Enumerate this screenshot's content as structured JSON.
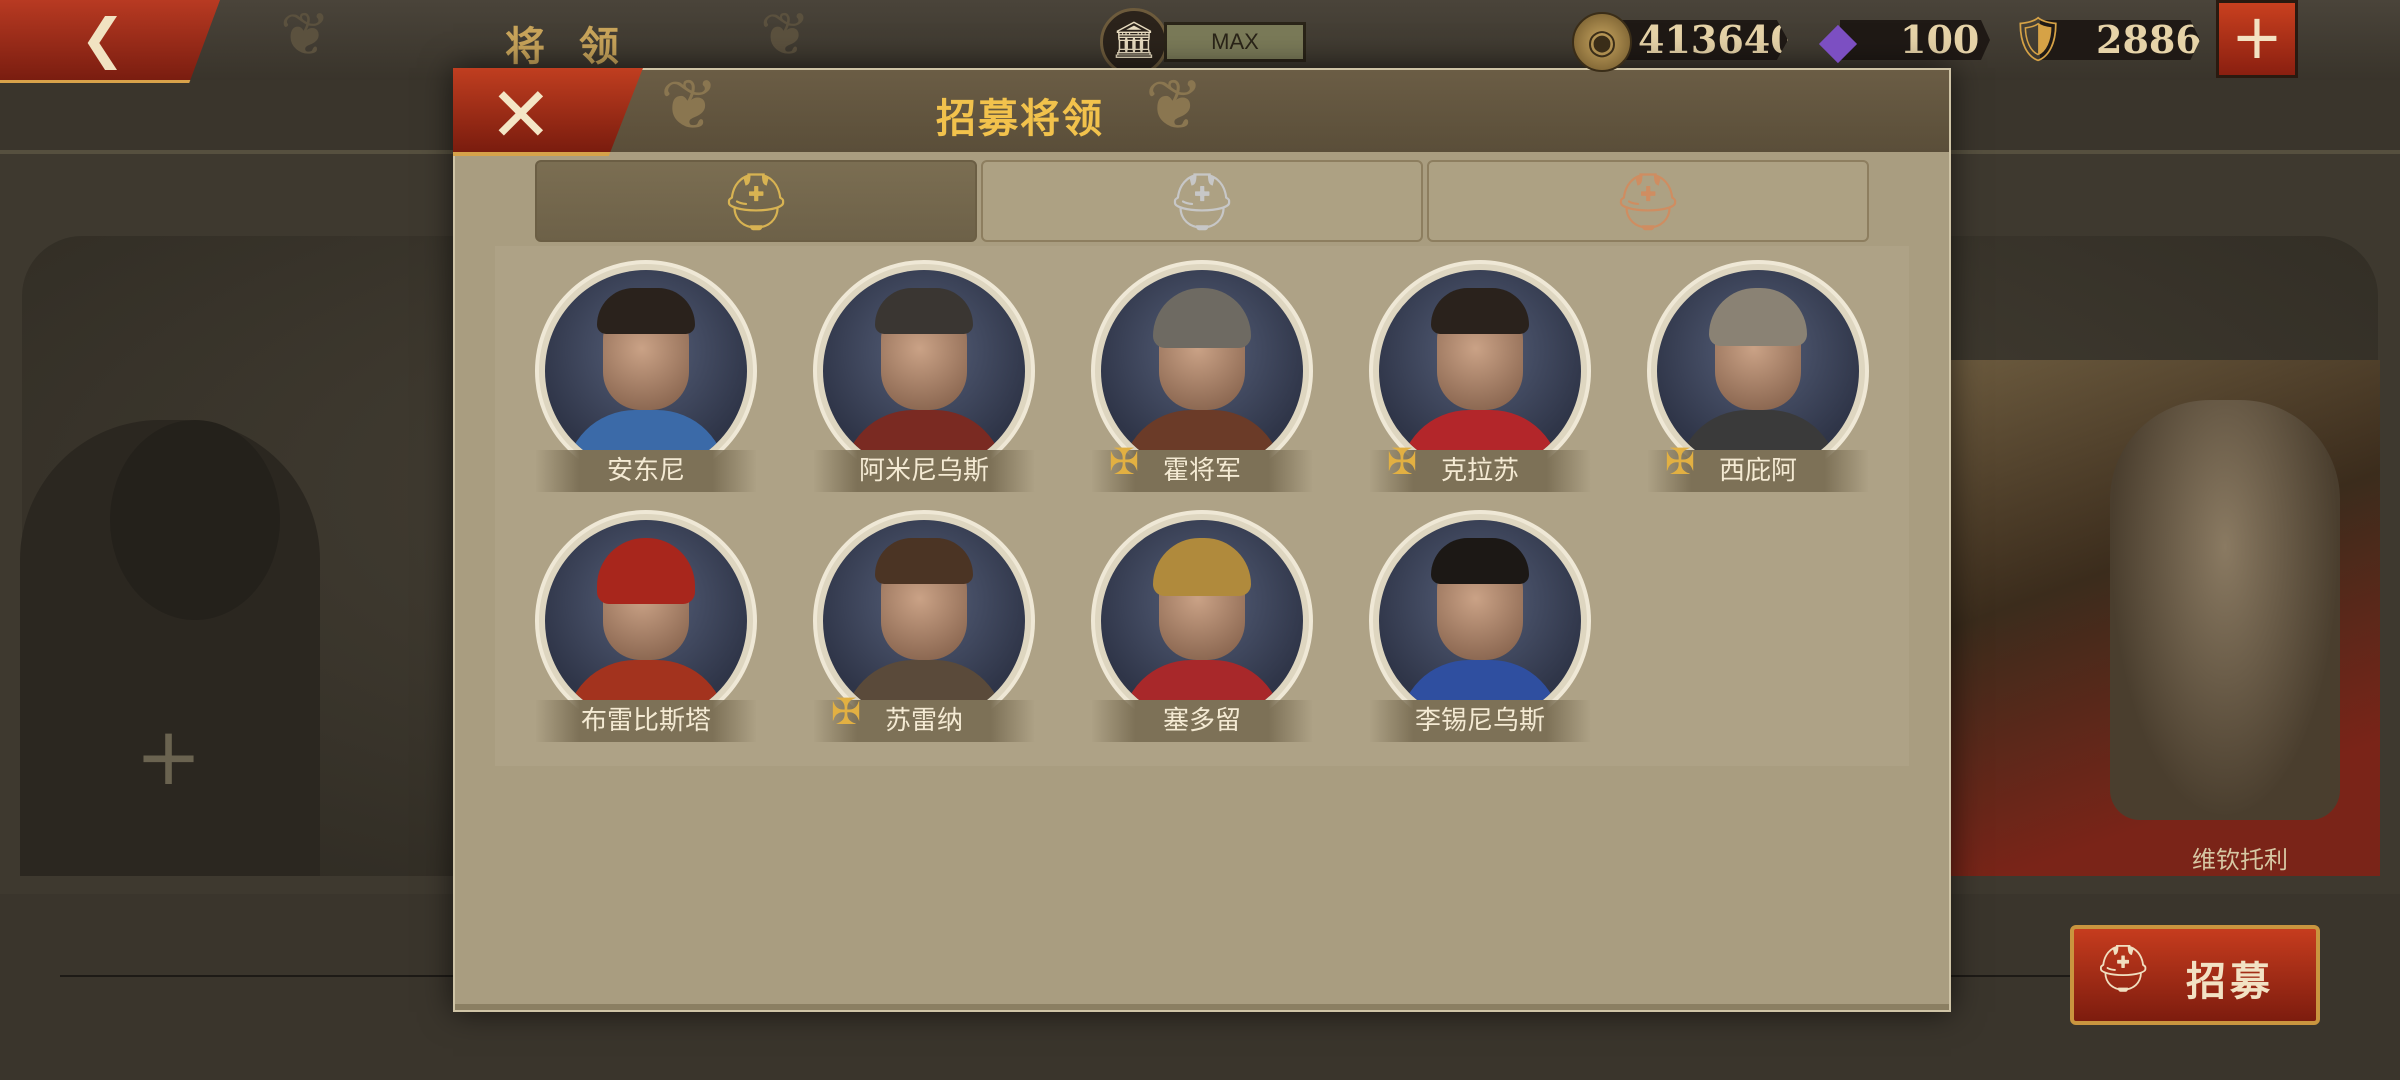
{
  "header": {
    "back_icon": "back-arrow-icon",
    "title": "将 领",
    "building_icon": "building-icon",
    "building_level": "MAX"
  },
  "resources": [
    {
      "name": "coin",
      "icon": "coin-icon",
      "value": "413640"
    },
    {
      "name": "gem",
      "icon": "gem-icon",
      "value": "100"
    },
    {
      "name": "spqr",
      "icon": "spqr-icon",
      "value": "2886"
    }
  ],
  "recruit_button": {
    "label": "招募"
  },
  "background": {
    "right_general_name": "维钦托利"
  },
  "modal": {
    "title": "招募将领",
    "close_icon": "close-icon",
    "tabs": [
      {
        "name": "gold",
        "icon": "gold-spartan-helmet-icon",
        "color": "#d8b352",
        "active": true
      },
      {
        "name": "silver",
        "icon": "silver-spartan-helmet-icon",
        "color": "#c7c7c7",
        "active": false
      },
      {
        "name": "bronze",
        "icon": "bronze-spartan-helmet-icon",
        "color": "#cf8d61",
        "active": false
      }
    ],
    "generals": [
      {
        "name": "安东尼",
        "badge": false,
        "body_color": "#3b6aa8"
      },
      {
        "name": "阿米尼乌斯",
        "badge": false,
        "body_color": "#7a2a22"
      },
      {
        "name": "霍将军",
        "badge": true,
        "body_color": "#6b3b28"
      },
      {
        "name": "克拉苏",
        "badge": true,
        "body_color": "#b3262a"
      },
      {
        "name": "西庇阿",
        "badge": true,
        "body_color": "#3a3a3a"
      },
      {
        "name": "布雷比斯塔",
        "badge": false,
        "body_color": "#a3331e"
      },
      {
        "name": "苏雷纳",
        "badge": true,
        "body_color": "#5a4a3a"
      },
      {
        "name": "塞多留",
        "badge": false,
        "body_color": "#a8282a"
      },
      {
        "name": "李锡尼乌斯",
        "badge": false,
        "body_color": "#2f4fa0"
      }
    ]
  }
}
